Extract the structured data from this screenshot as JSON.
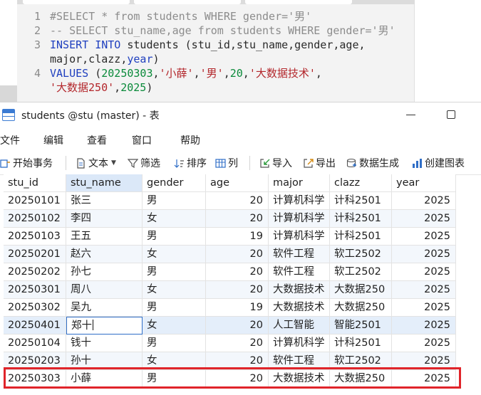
{
  "editor": {
    "lines": [
      {
        "num": "1",
        "tokens": [
          {
            "t": "#SELECT * from students WHERE gender='男'",
            "c": "com"
          }
        ]
      },
      {
        "num": "2",
        "tokens": [
          {
            "t": "-- SELECT stu_name,age from students WHERE gender='男'",
            "c": "com"
          }
        ]
      },
      {
        "num": "3",
        "tokens": [
          {
            "t": "INSERT INTO",
            "c": "kw"
          },
          {
            "t": " students (stu_id,stu_name,gender,age,",
            "c": "plain"
          }
        ]
      },
      {
        "num": "",
        "tokens": [
          {
            "t": "major,clazz,",
            "c": "plain"
          },
          {
            "t": "year",
            "c": "kw"
          },
          {
            "t": ")",
            "c": "plain"
          }
        ]
      },
      {
        "num": "4",
        "tokens": [
          {
            "t": "VALUES",
            "c": "kw"
          },
          {
            "t": " (",
            "c": "punc"
          },
          {
            "t": "20250303",
            "c": "num"
          },
          {
            "t": ",",
            "c": "punc"
          },
          {
            "t": "'小薛'",
            "c": "str"
          },
          {
            "t": ",",
            "c": "punc"
          },
          {
            "t": "'男'",
            "c": "str"
          },
          {
            "t": ",",
            "c": "punc"
          },
          {
            "t": "20",
            "c": "num"
          },
          {
            "t": ",",
            "c": "punc"
          },
          {
            "t": "'大数据技术'",
            "c": "str"
          },
          {
            "t": ",",
            "c": "punc"
          }
        ]
      },
      {
        "num": "",
        "tokens": [
          {
            "t": "'大数据250'",
            "c": "str"
          },
          {
            "t": ",",
            "c": "punc"
          },
          {
            "t": "2025",
            "c": "num"
          },
          {
            "t": ")",
            "c": "punc"
          }
        ]
      }
    ]
  },
  "window": {
    "title": "students @stu (master) - 表"
  },
  "menu": [
    "文件",
    "编辑",
    "查看",
    "窗口",
    "帮助"
  ],
  "toolbar": {
    "begin_tx": "开始事务",
    "text": "文本",
    "filter": "筛选",
    "sort": "排序",
    "columns": "列",
    "import": "导入",
    "export": "导出",
    "generate": "数据生成",
    "chart": "创建图表"
  },
  "table": {
    "columns": [
      "stu_id",
      "stu_name",
      "gender",
      "age",
      "major",
      "clazz",
      "year"
    ],
    "rows": [
      [
        "20250101",
        "张三",
        "男",
        "20",
        "计算机科学",
        "计科2501",
        "2025"
      ],
      [
        "20250102",
        "李四",
        "女",
        "20",
        "计算机科学",
        "计科2501",
        "2025"
      ],
      [
        "20250103",
        "王五",
        "男",
        "19",
        "计算机科学",
        "计科2501",
        "2025"
      ],
      [
        "20250201",
        "赵六",
        "女",
        "20",
        "软件工程",
        "软工2502",
        "2025"
      ],
      [
        "20250202",
        "孙七",
        "男",
        "20",
        "软件工程",
        "软工2502",
        "2025"
      ],
      [
        "20250301",
        "周八",
        "女",
        "20",
        "大数据技术",
        "大数据250",
        "2025"
      ],
      [
        "20250302",
        "吴九",
        "男",
        "19",
        "大数据技术",
        "大数据250",
        "2025"
      ],
      [
        "20250401",
        "郑十",
        "女",
        "20",
        "人工智能",
        "智能2501",
        "2025"
      ],
      [
        "20250104",
        "钱十",
        "男",
        "20",
        "计算机科学",
        "计科2501",
        "2025"
      ],
      [
        "20250203",
        "孙十",
        "女",
        "20",
        "软件工程",
        "软工2502",
        "2025"
      ],
      [
        "20250303",
        "小薛",
        "男",
        "20",
        "大数据技术",
        "大数据250",
        "2025"
      ]
    ]
  },
  "colors": {
    "keyword": "#1f3fbf",
    "string": "#b3262b",
    "number": "#0a8a3a",
    "comment": "#8c8c8c",
    "selection": "#2f6ec7",
    "highlight": "#e0242a"
  }
}
